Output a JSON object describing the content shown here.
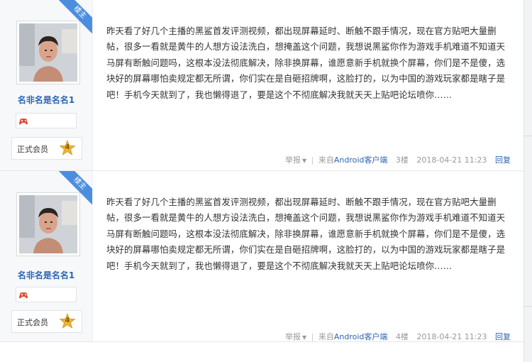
{
  "posts": [
    {
      "badge": "楼主",
      "username": "名非名是名名1",
      "member_label": "正式会员",
      "level": "4",
      "content": "昨天看了好几个主播的黑鲨首发评测视频，都出现屏幕延时、断触不跟手情况，现在官方贴吧大量删帖，很多一看就是黄牛的人想方设法洗白，想掩盖这个问题，我想说黑鲨你作为游戏手机难道不知道天马屏有断触问题吗，这根本没法彻底解决，除非换屏幕，谁愿意新手机就换个屏幕，你们是不是傻，选块好的屏幕哪怕卖规定都无所谓，你们实在是自砸招牌啊，这脸打的，以为中国的游戏玩家都是瞎子是吧！手机今天就到了，我也懒得退了，要是这个不彻底解决我就天天上贴吧论坛喷你……",
      "report": "举报",
      "source_prefix": "来自",
      "source_app": "Android客户端",
      "floor": "3楼",
      "time": "2018-04-21 11:23",
      "reply": "回复"
    },
    {
      "badge": "楼主",
      "username": "名非名是名名1",
      "member_label": "正式会员",
      "level": "4",
      "content": "昨天看了好几个主播的黑鲨首发评测视频，都出现屏幕延时、断触不跟手情况，现在官方贴吧大量删帖，很多一看就是黄牛的人想方设法洗白，想掩盖这个问题，我想说黑鲨你作为游戏手机难道不知道天马屏有断触问题吗，这根本没法彻底解决，除非换屏幕，谁愿意新手机就换个屏幕，你们是不是傻，选块好的屏幕哪怕卖规定都无所谓，你们实在是自砸招牌啊，这脸打的，以为中国的游戏玩家都是瞎子是吧！手机今天就到了，我也懒得退了，要是这个不彻底解决我就天天上贴吧论坛喷你……",
      "report": "举报",
      "source_prefix": "来自",
      "source_app": "Android客户端",
      "floor": "4楼",
      "time": "2018-04-21 11:23",
      "reply": "回复"
    }
  ],
  "icons": {
    "ribbon": "author-ribbon-icon",
    "badge": "game-controller-icon",
    "level": "star-level-icon"
  },
  "colors": {
    "link": "#2d64b3",
    "ribbon": "#4b8ee0",
    "level_star": "#e8b43a"
  }
}
